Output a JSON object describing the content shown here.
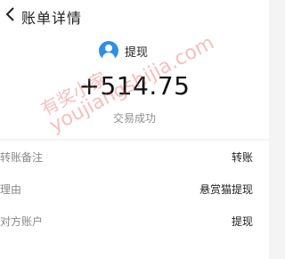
{
  "header": {
    "title": "账单详情",
    "back_icon": "chevron-left-icon"
  },
  "summary": {
    "payee": "提现",
    "avatar_icon": "user-avatar-icon",
    "amount": "+514.75",
    "status": "交易成功"
  },
  "details": [
    {
      "label": "转账备注",
      "value": "转账"
    },
    {
      "label": "理由",
      "value": "悬赏猫提现"
    },
    {
      "label": "对方账户",
      "value": "提现"
    }
  ],
  "watermark": {
    "line1": "有奖小家",
    "line2": "youjiangshijia.com"
  },
  "colors": {
    "accent": "#2f8fe6",
    "watermark": "#e64646"
  }
}
